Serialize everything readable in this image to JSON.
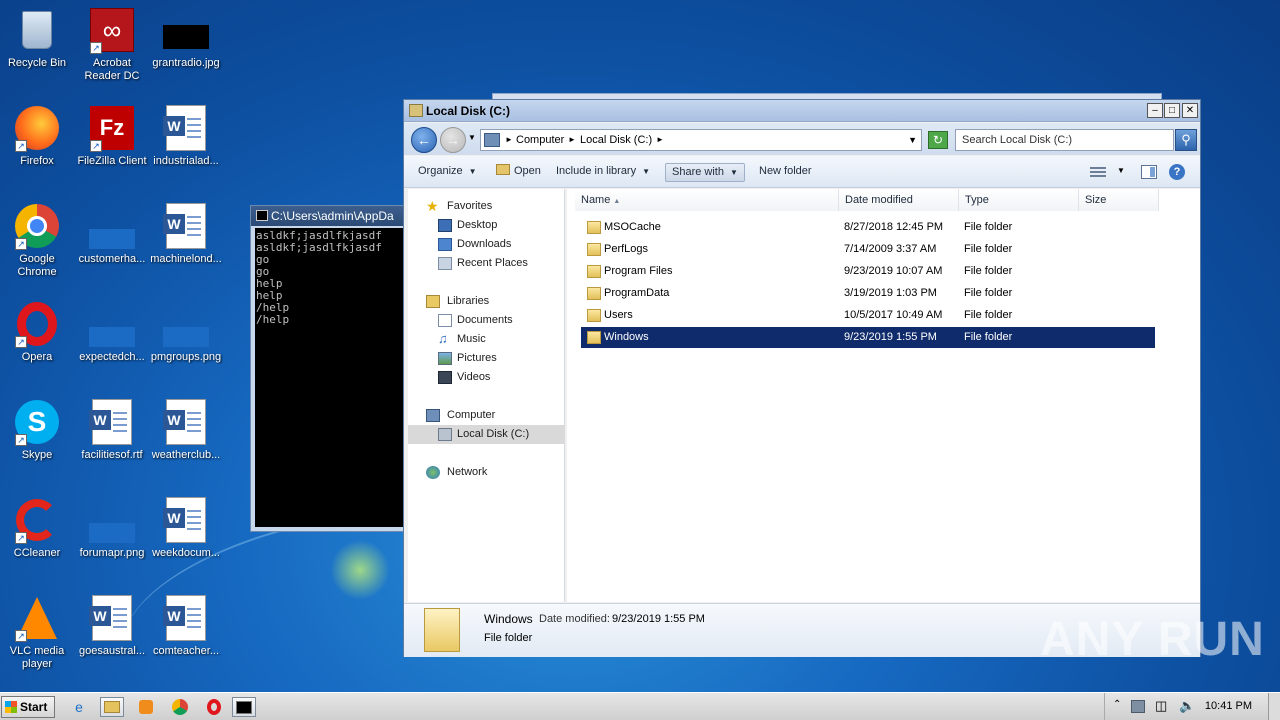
{
  "desktop": {
    "icons": [
      {
        "label": "Recycle Bin"
      },
      {
        "label": "Acrobat Reader DC"
      },
      {
        "label": "grantradio.jpg"
      },
      {
        "label": "Firefox"
      },
      {
        "label": "FileZilla Client"
      },
      {
        "label": "industrialad..."
      },
      {
        "label": "Google Chrome"
      },
      {
        "label": "customerha..."
      },
      {
        "label": "machinelond..."
      },
      {
        "label": "Opera"
      },
      {
        "label": "expectedch..."
      },
      {
        "label": "pmgroups.png"
      },
      {
        "label": "Skype"
      },
      {
        "label": "facilitiesof.rtf"
      },
      {
        "label": "weatherclub..."
      },
      {
        "label": "CCleaner"
      },
      {
        "label": "forumapr.png"
      },
      {
        "label": "weekdocum..."
      },
      {
        "label": "VLC media player"
      },
      {
        "label": "goesaustral..."
      },
      {
        "label": "comteacher..."
      }
    ]
  },
  "console": {
    "title": "C:\\Users\\admin\\AppDa",
    "text": "asldkf;jasdlfkjasdf\nasldkf;jasdlfkjasdf\ngo\ngo\nhelp\nhelp\n/help\n/help"
  },
  "explorer": {
    "title": "Local Disk (C:)",
    "address": {
      "crumb1": "Computer",
      "crumb2": "Local Disk (C:)"
    },
    "search_placeholder": "Search Local Disk (C:)",
    "toolbar": {
      "organize": "Organize",
      "open": "Open",
      "include": "Include in library",
      "share": "Share with",
      "newfolder": "New folder"
    },
    "nav": {
      "favorites": "Favorites",
      "desktop": "Desktop",
      "downloads": "Downloads",
      "recent": "Recent Places",
      "libraries": "Libraries",
      "documents": "Documents",
      "music": "Music",
      "pictures": "Pictures",
      "videos": "Videos",
      "computer": "Computer",
      "localdisk": "Local Disk (C:)",
      "network": "Network"
    },
    "columns": {
      "name": "Name",
      "date": "Date modified",
      "type": "Type",
      "size": "Size"
    },
    "files": [
      {
        "name": "MSOCache",
        "date": "8/27/2018 12:45 PM",
        "type": "File folder"
      },
      {
        "name": "PerfLogs",
        "date": "7/14/2009 3:37 AM",
        "type": "File folder"
      },
      {
        "name": "Program Files",
        "date": "9/23/2019 10:07 AM",
        "type": "File folder"
      },
      {
        "name": "ProgramData",
        "date": "3/19/2019 1:03 PM",
        "type": "File folder"
      },
      {
        "name": "Users",
        "date": "10/5/2017 10:49 AM",
        "type": "File folder"
      },
      {
        "name": "Windows",
        "date": "9/23/2019 1:55 PM",
        "type": "File folder"
      }
    ],
    "details": {
      "name": "Windows",
      "date_label": "Date modified:",
      "date": "9/23/2019 1:55 PM",
      "type": "File folder"
    }
  },
  "taskbar": {
    "start": "Start",
    "clock": "10:41 PM"
  },
  "watermark": "ANY RUN"
}
